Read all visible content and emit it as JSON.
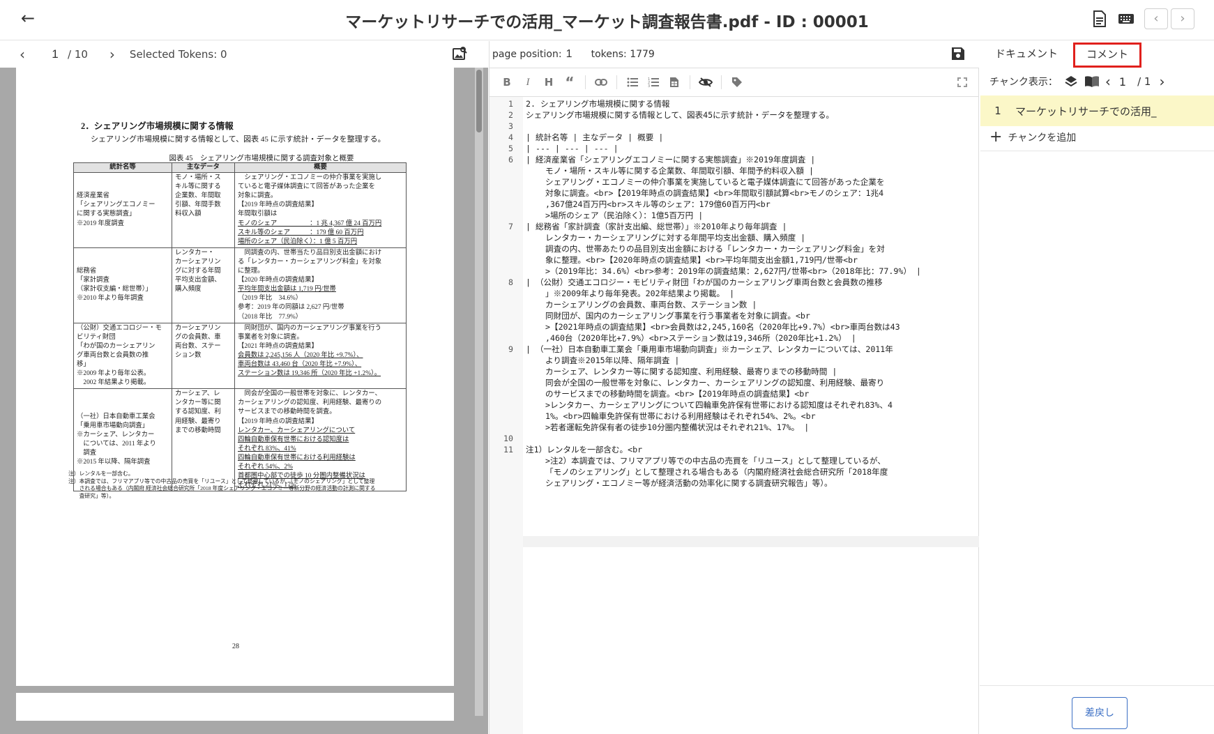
{
  "header": {
    "title": "マーケットリサーチでの活用_マーケット調査報告書.pdf - ID : 00001"
  },
  "pdf_toolbar": {
    "page": "1",
    "total": "/ 10",
    "selected_tokens": "Selected Tokens: 0"
  },
  "pdf_page": {
    "heading": "2．シェアリング市場規模に関する情報",
    "intro": "シェアリング市場規模に関する情報として、図表 45 に示す統計・データを整理する。",
    "caption": "図表 45　シェアリング市場規模に関する調査対象と概要",
    "columns": [
      "統計名等",
      "主なデータ",
      "概要"
    ],
    "rows": [
      {
        "name": [
          "経済産業省",
          "「シェアリングエコノミー",
          "に関する実態調査」",
          "※2019 年度調査"
        ],
        "data": [
          "モノ・場所・ス",
          "キル等に関する",
          "企業数、年間取",
          "引額、年間手数",
          "料収入額"
        ],
        "summary": [
          "　シェアリング・エコノミーの仲介事業を実施し",
          "ていると電子媒体調査にて回答があった企業を",
          "対象に調査。",
          "【2019 年時点の調査結果】",
          "年間取引額は",
          "モノのシェア　　　　　：1 兆 4,367 億 24 百万円",
          "スキル等のシェア　　　：179 億 60 百万円",
          "場所のシェア（民泊除く）：1 億 5 百万円"
        ]
      },
      {
        "name": [
          "総務省",
          "「家計調査",
          "（家計収支編・総世帯）」",
          "※2010 年より毎年調査"
        ],
        "data": [
          "レンタカー・",
          "カーシェアリン",
          "グに対する年間",
          "平均支出金額、",
          "購入頻度"
        ],
        "summary": [
          "　同調査の内、世帯当たり品目別支出金額におけ",
          "る「レンタカー・カーシェアリング料金」を対象",
          "に整理。",
          "【2020 年時点の調査結果】",
          "平均年間支出金額は 1,719 円/世帯",
          "（2019 年比　34.6%）",
          "参考：2019 年の同額は 2,627 円/世帯",
          "（2018 年比　77.9%）"
        ]
      },
      {
        "name": [
          "（公財）交通エコロジー・モ",
          "ビリティ財団",
          "「わが国のカーシェアリン",
          "グ車両台数と会員数の推",
          "移」",
          "※2009 年より毎年公表。",
          "　2002 年結果より掲載。"
        ],
        "data": [
          "カーシェアリン",
          "グの会員数、車",
          "両台数、ステー",
          "ション数"
        ],
        "summary": [
          "　同財団が、国内のカーシェアリング事業を行う",
          "事業者を対象に調査。",
          "【2021 年時点の調査結果】",
          "会員数は 2,245,156 人（2020 年比 +9.7%）、",
          "車両台数は 43,460 台（2020 年比 +7.9%）、",
          "ステーション数は 19,346 所（2020 年比 +1.2%）。"
        ]
      },
      {
        "name": [
          "（一社）日本自動車工業会",
          "「乗用車市場動向調査」",
          "※カーシェア、レンタカー",
          "　については、2011 年より",
          "　調査",
          "※2015 年以降、隔年調査"
        ],
        "data": [
          "カーシェア、レ",
          "ンタカー等に関",
          "する認知度、利",
          "用経験、最寄り",
          "までの移動時間"
        ],
        "summary": [
          "　同会が全国の一般世帯を対象に、レンタカー、",
          "カーシェアリングの認知度、利用経験、最寄りの",
          "サービスまでの移動時間を調査。",
          "【2019 年時点の調査結果】",
          "レンタカー、カーシェアリングについて",
          "四輪自動車保有世帯における認知度は",
          "それぞれ 83%、41%",
          "四輪自動車保有世帯における利用経験は",
          "それぞれ 54%、2%",
          "首都圏中心部での徒歩 10 分圏内整備状況は",
          "それぞれ 21%、17%"
        ]
      }
    ],
    "notes": [
      "注）レンタルを一部含む。",
      "注）本調査では、フリマアプリ等での中古品の売買を「リユース」として整理しているが、「モノのシェアリング」として整理",
      "　　される場合もある（内閣府 経済社会総合研究所「2018 年度シェアリング・エコノミー等新分野の経済活動の計測に関する",
      "　　査研究」等）。"
    ],
    "page_number": "28"
  },
  "editor": {
    "page_position_label": "page position:",
    "page_position": "1",
    "tokens": "tokens: 1779",
    "lines": [
      {
        "n": "1",
        "t": [
          "2. シェアリング市場規模に関する情報"
        ]
      },
      {
        "n": "2",
        "t": [
          "シェアリング市場規模に関する情報として、図表45に示す統計・データを整理する。"
        ]
      },
      {
        "n": "3",
        "t": [
          ""
        ]
      },
      {
        "n": "4",
        "t": [
          "| 統計名等 | 主なデータ | 概要 |"
        ]
      },
      {
        "n": "5",
        "t": [
          "| --- | --- | --- |"
        ]
      },
      {
        "n": "6",
        "t": [
          "| 経済産業省「シェアリングエコノミーに関する実態調査」※2019年度調査 |",
          "モノ・場所・スキル等に関する企業数、年間取引額、年間予約料収入額 |",
          "シェアリング・エコノミーの仲介事業を実施していると電子媒体調査にて回答があった企業を",
          "対象に調査。<br>【2019年時点の調査結果】<br>年間取引額試算<br>モノのシェア：1兆4",
          ",367億24百万円<br>スキル等のシェア：179億60百万円<br",
          ">場所のシェア（民泊除く）：1億5百万円 |"
        ]
      },
      {
        "n": "7",
        "t": [
          "| 総務省「家計調査（家計支出編、総世帯）」※2010年より毎年調査 |",
          "レンタカー・カーシェアリングに対する年間平均支出金額、購入頻度 |",
          "調査の内、世帯あたりの品目別支出金額における「レンタカー・カーシェアリング料金」を対",
          "象に整理。<br>【2020年時点の調査結果】<br>平均年間支出金額1,719円/世帯<br",
          ">（2019年比：34.6%）<br>参考：2019年の調査結果：2,627円/世帯<br>（2018年比：77.9%） |"
        ]
      },
      {
        "n": "8",
        "t": [
          "| （公財）交通エコロジー・モビリティ財団「わが国のカーシェアリング車両台数と会員数の推移",
          "」※2009年より毎年発表。202年結果より掲載。 |",
          "カーシェアリングの会員数、車両台数、ステーション数 |",
          "同財団が、国内のカーシェアリング事業を行う事業者を対象に調査。<br",
          ">【2021年時点の調査結果】<br>会員数は2,245,160名（2020年比+9.7%）<br>車両台数は43",
          ",460台（2020年比+7.9%）<br>ステーション数は19,346所（2020年比+1.2%） |"
        ]
      },
      {
        "n": "9",
        "t": [
          "| （一社）日本自動車工業会「乗用車市場動向調査」※カーシェア、レンタカーについては、2011年",
          "より調査※2015年以降、隔年調査 |",
          "カーシェア、レンタカー等に関する認知度、利用経験、最寄りまでの移動時間 |",
          "同会が全国の一般世帯を対象に、レンタカー、カーシェアリングの認知度、利用経験、最寄り",
          "のサービスまでの移動時間を調査。<br>【2019年時点の調査結果】<br",
          ">レンタカー、カーシェアリングについて四輪車免許保有世帯における認知度はそれぞれ83%、4",
          "1%。<br>四輪車免許保有世帯における利用経験はそれぞれ54%、2%。<br",
          ">若者運転免許保有者の徒歩10分圏内整備状況はそれぞれ21%、17%。 |"
        ]
      },
      {
        "n": "10",
        "t": [
          ""
        ]
      },
      {
        "n": "11",
        "t": [
          "注1）レンタルを一部含む。<br",
          ">注2）本調査では、フリマアプリ等での中古品の売買を「リユース」として整理しているが、",
          "「モノのシェアリング」として整理される場合もある（内閣府経済社会総合研究所「2018年度",
          "シェアリング・エコノミー等が経済活動の効率化に関する調査研究報告」等）。"
        ]
      }
    ]
  },
  "right_panel": {
    "tabs": [
      "ドキュメント",
      "コメント"
    ],
    "chunk_label": "チャンク表示：",
    "chunk_page": "1",
    "chunk_total": "/ 1",
    "chunk_item": {
      "num": "1",
      "label": "マーケットリサーチでの活用_"
    },
    "add_chunk": "チャンクを追加",
    "revert": "差戻し"
  },
  "colors": {
    "active_tab_border": "#e0201c",
    "chunk_highlight": "#fbf7c8",
    "revert_button": "#3b6fc4"
  }
}
